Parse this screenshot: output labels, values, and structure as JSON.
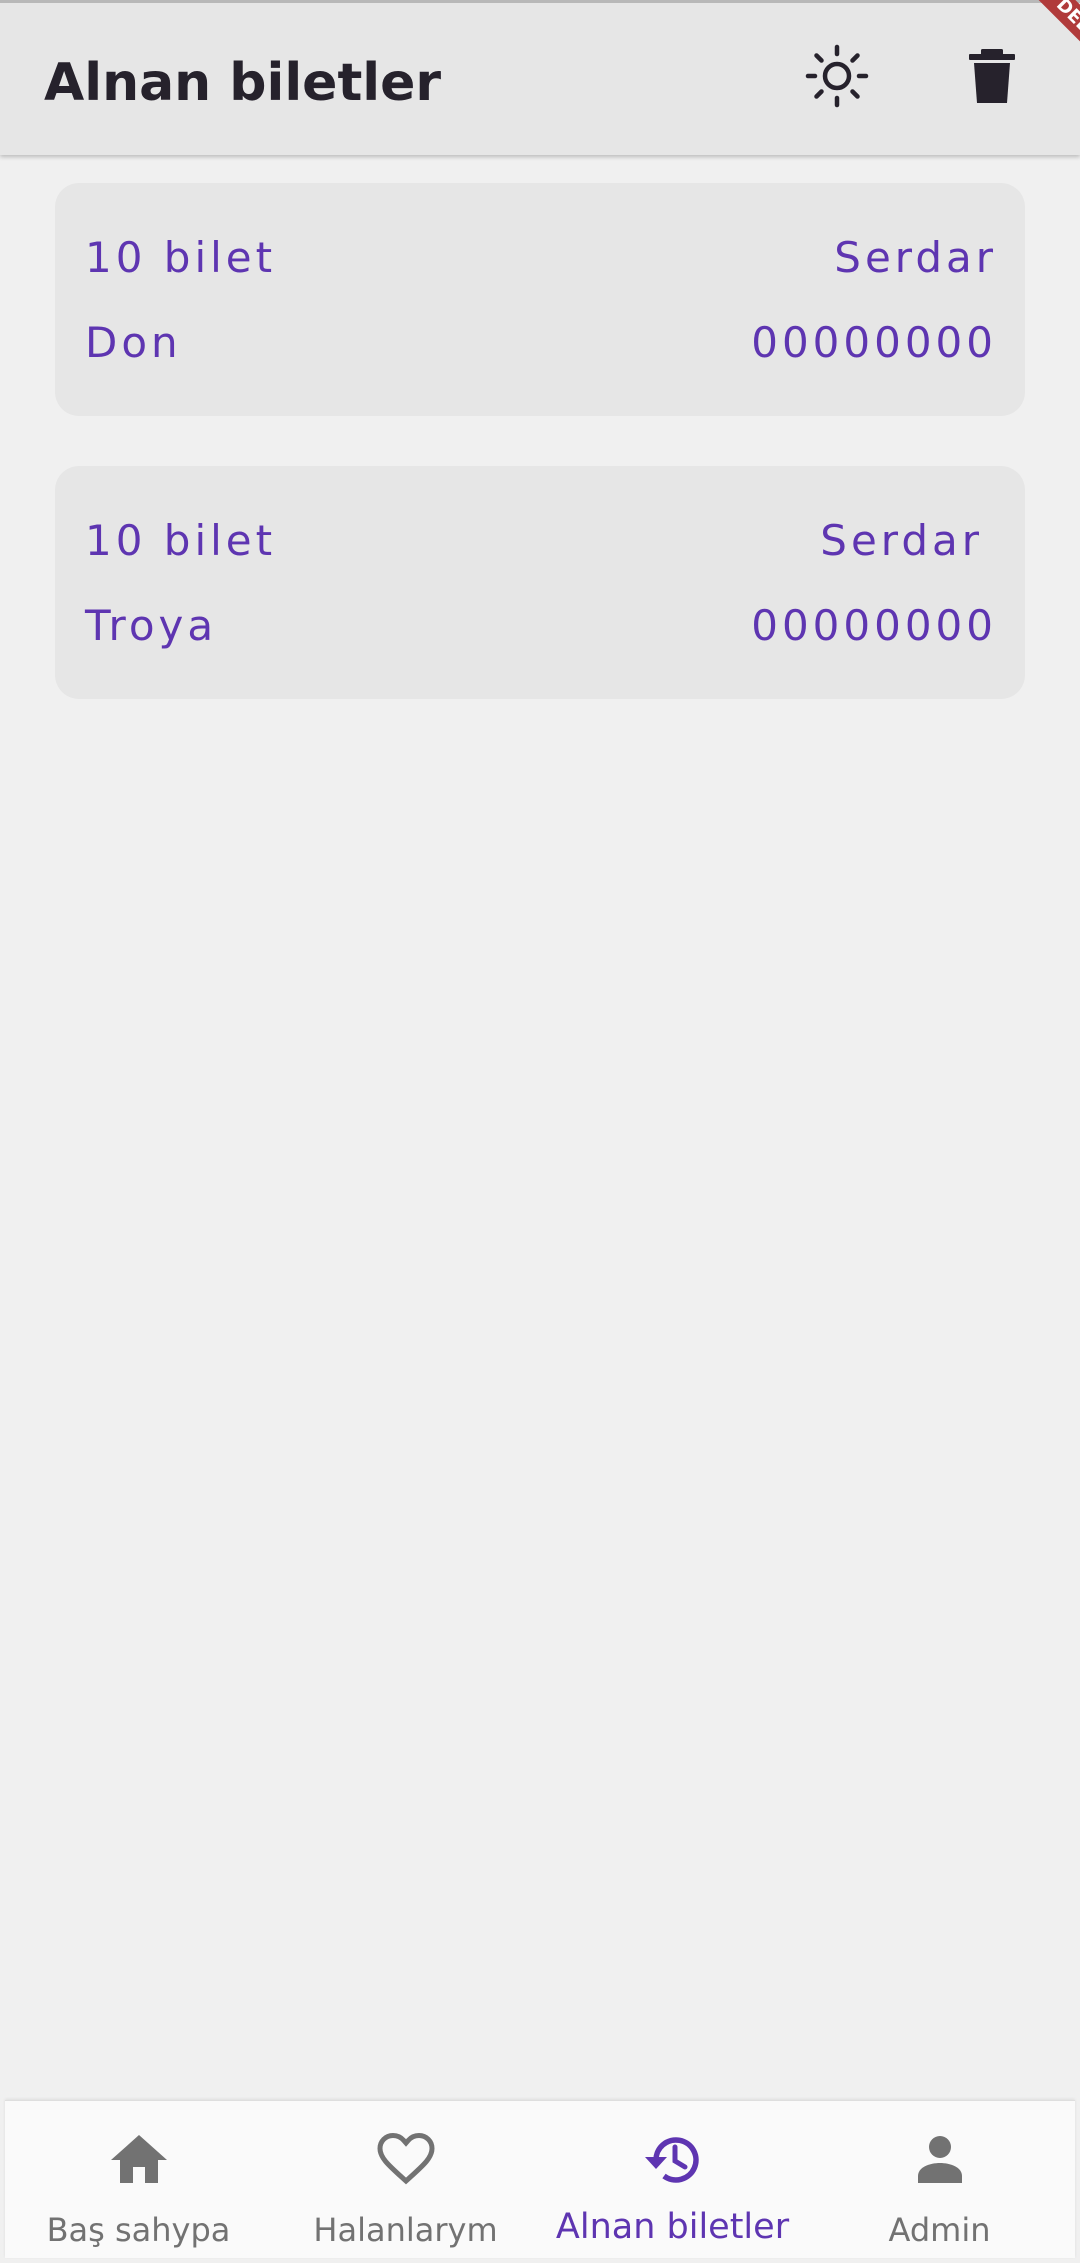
{
  "app_bar": {
    "title": "Alnan biletler",
    "icons": [
      "sun-icon",
      "trash-icon"
    ]
  },
  "debug_banner": "DEBUG",
  "tickets": [
    {
      "count": "10 bilet",
      "name": "Serdar",
      "title": "Don",
      "phone": "00000000"
    },
    {
      "count": "10 bilet",
      "name": "Serdar",
      "title": "Troya",
      "phone": "00000000"
    }
  ],
  "bottom_nav": {
    "items": [
      {
        "label": "Baş sahypa",
        "icon": "home-icon",
        "active": false
      },
      {
        "label": "Halanlarym",
        "icon": "heart-outline-icon",
        "active": false
      },
      {
        "label": "Alnan biletler",
        "icon": "history-icon",
        "active": true
      },
      {
        "label": "Admin",
        "icon": "person-icon",
        "active": false
      }
    ]
  },
  "colors": {
    "accent": "#5e35b1",
    "app_bar_bg": "#e6e6e6",
    "page_bg": "#f0f0f0",
    "card_bg": "#e6e6e6",
    "title_text": "#26222c",
    "nav_inactive": "#727272",
    "debug_banner": "#b03a3a"
  }
}
